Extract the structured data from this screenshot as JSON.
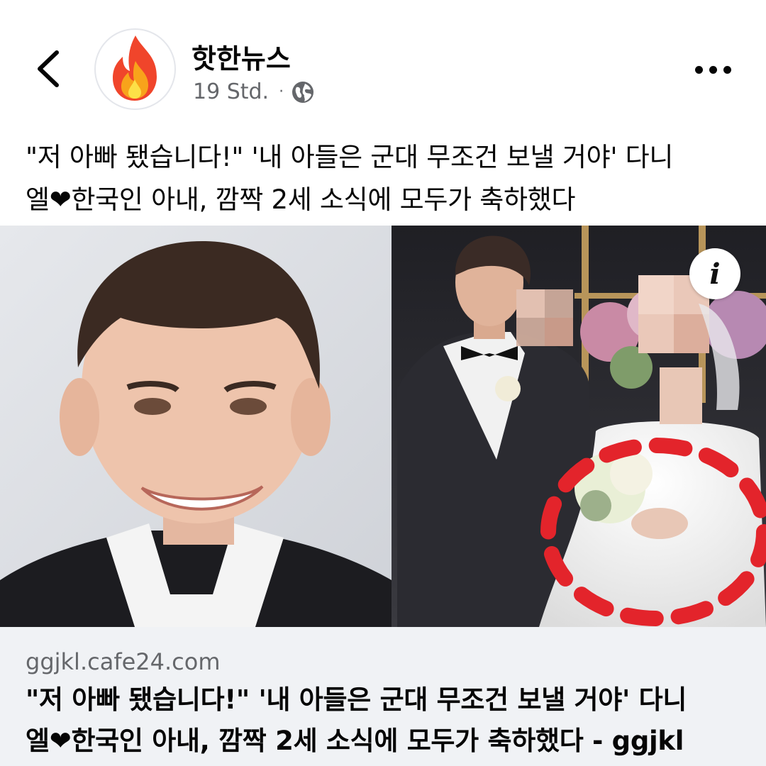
{
  "header": {
    "back_icon": "chevron-left-icon",
    "avatar_icon": "fire-icon",
    "page_name": "핫한뉴스",
    "time": "19 Std.",
    "separator": "·",
    "privacy_icon": "globe-icon",
    "more_icon": "more-dots-icon"
  },
  "post": {
    "text_line1": "\"저 아빠 됐습니다!\" '내 아들은 군대 무조건 보낼 거야' 다니",
    "text_line2": "엘❤한국인 아내, 깜짝 2세 소식에 모두가 축하했다"
  },
  "media": {
    "info_label": "i",
    "info_icon": "info-icon",
    "highlight_color": "#e3242b"
  },
  "link": {
    "domain": "ggjkl.cafe24.com",
    "title_line1": "\"저 아빠 됐습니다!\" '내 아들은 군대 무조건 보낼 거야' 다니",
    "title_line2": "엘❤한국인 아내, 깜짝 2세 소식에 모두가 축하했다 - ggjkl"
  },
  "colors": {
    "primary_text": "#050505",
    "secondary_text": "#65676b",
    "card_bg": "#f0f2f5"
  }
}
